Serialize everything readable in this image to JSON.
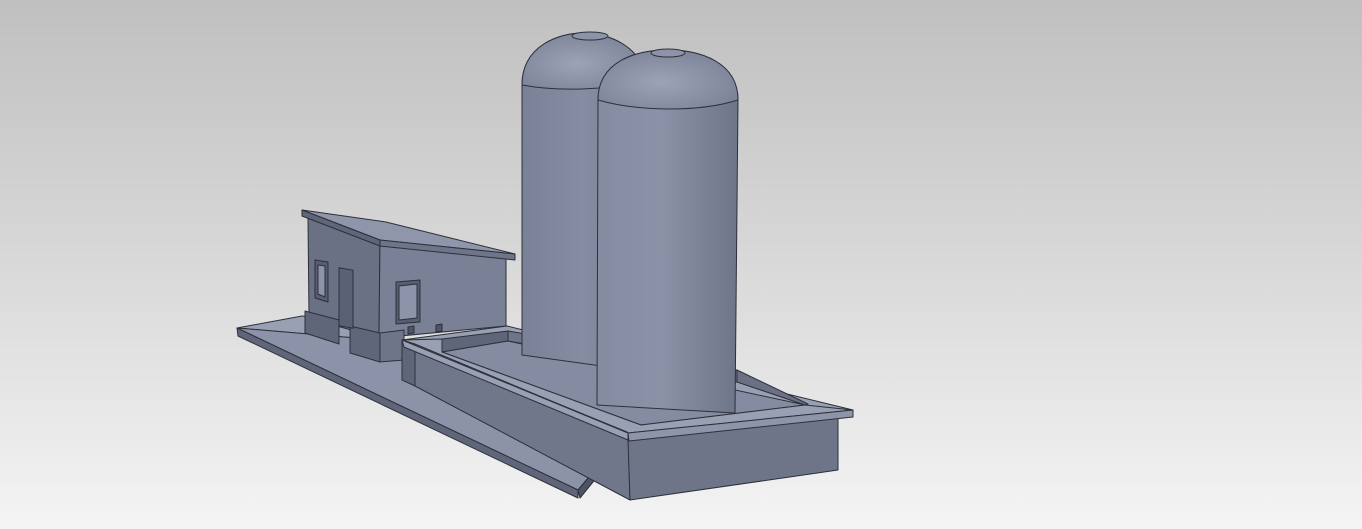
{
  "viewport": {
    "background_top": "#c0c0c0",
    "background_bottom": "#f6f6f6"
  },
  "model": {
    "base_color": "#8a91a6",
    "light_face": "#9aa0b3",
    "dark_face": "#5f667a",
    "darker_face": "#4e5466",
    "edge_color": "#2d303a",
    "parts": [
      "base-slab",
      "pump-house",
      "roof",
      "containment-basin",
      "tank-rear",
      "tank-front"
    ]
  }
}
